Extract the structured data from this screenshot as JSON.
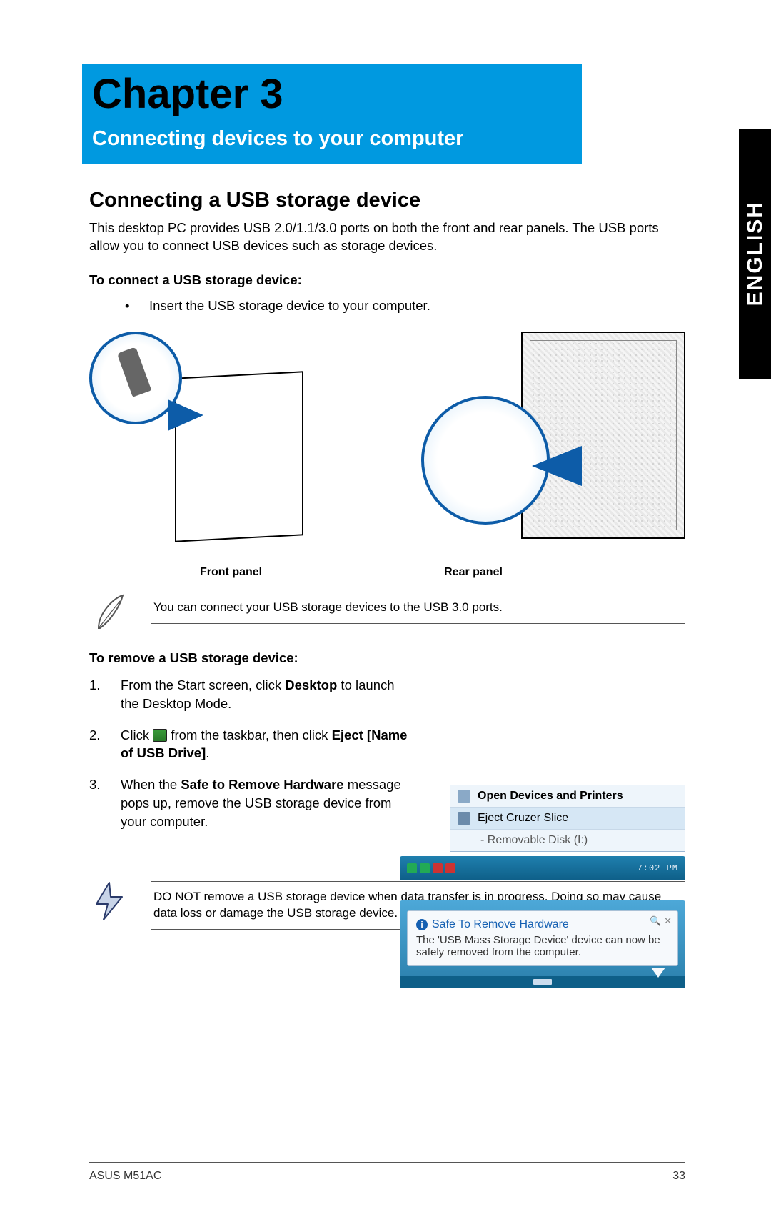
{
  "lang_tab": "ENGLISH",
  "chapter": {
    "title": "Chapter 3",
    "subtitle": "Connecting devices to your computer"
  },
  "section": {
    "heading": "Connecting a USB storage device",
    "intro": "This desktop PC provides USB 2.0/1.1/3.0 ports on both the front and rear panels. The USB ports allow you to connect USB devices such as storage devices.",
    "connect_label": "To connect a USB storage device:",
    "connect_step": "Insert the USB storage device to your computer.",
    "front_label": "Front panel",
    "rear_label": "Rear panel",
    "note": "You can connect your USB storage devices to the USB 3.0 ports.",
    "remove_label": "To remove a USB storage device:",
    "steps": [
      {
        "n": "1.",
        "pre": "From the Start screen, click ",
        "b1": "Desktop",
        "post": " to launch the Desktop Mode."
      },
      {
        "n": "2.",
        "pre": "Click ",
        "mid": " from the taskbar, then click ",
        "b1": "Eject [Name of USB Drive]",
        "post": "."
      },
      {
        "n": "3.",
        "pre": "When the ",
        "b1": "Safe to Remove Hardware",
        "post": " message pops up, remove the USB storage device from your computer."
      }
    ],
    "warning": "DO NOT remove a USB storage device when data transfer is in progress. Doing so may cause data loss or damage the USB storage device."
  },
  "screenshot": {
    "menu_open": "Open Devices and Printers",
    "menu_eject": "Eject Cruzer Slice",
    "menu_sub": "-   Removable Disk (I:)",
    "taskbar_time": "7:02 PM",
    "balloon_title": "Safe To Remove Hardware",
    "balloon_body": "The 'USB Mass Storage Device' device can now be safely removed from the computer."
  },
  "footer": {
    "model": "ASUS M51AC",
    "page": "33"
  }
}
